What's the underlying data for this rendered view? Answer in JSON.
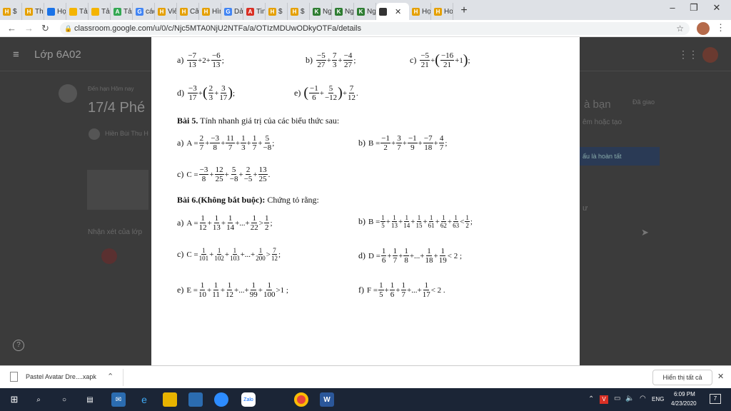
{
  "browser": {
    "tabs": [
      {
        "label": "$ ",
        "color": "#e5a000",
        "letter": "H"
      },
      {
        "label": "Thc",
        "color": "#e5a000",
        "letter": "H"
      },
      {
        "label": "Họ",
        "color": "#1a73e8",
        "letter": ""
      },
      {
        "label": "Tải",
        "color": "#f4b400",
        "letter": ""
      },
      {
        "label": "Tải",
        "color": "#f4b400",
        "letter": ""
      },
      {
        "label": "Tải",
        "color": "#34a853",
        "letter": "A"
      },
      {
        "label": "các",
        "color": "#4285f4",
        "letter": "G"
      },
      {
        "label": "Viê",
        "color": "#e5a000",
        "letter": "H"
      },
      {
        "label": "Câu",
        "color": "#e5a000",
        "letter": "H"
      },
      {
        "label": "Hìn",
        "color": "#e5a000",
        "letter": "H"
      },
      {
        "label": "Dải",
        "color": "#4285f4",
        "letter": "G"
      },
      {
        "label": "Tin",
        "color": "#d93025",
        "letter": "A"
      },
      {
        "label": "$ ",
        "color": "#e5a000",
        "letter": "H"
      },
      {
        "label": "$ ",
        "color": "#e5a000",
        "letter": "H"
      },
      {
        "label": "Ng",
        "color": "#2e7d32",
        "letter": "K"
      },
      {
        "label": "Ng",
        "color": "#2e7d32",
        "letter": "K"
      },
      {
        "label": "Ng",
        "color": "#2e7d32",
        "letter": "K"
      },
      {
        "label": "Họ",
        "color": "#e5a000",
        "letter": "H"
      },
      {
        "label": "Ho",
        "color": "#e5a000",
        "letter": "H"
      }
    ],
    "active_tab_close": "✕",
    "new_tab": "+",
    "url": "classroom.google.com/u/0/c/Njc5MTA0NjU2NTFa/a/OTIzMDUwODkyOTFa/details"
  },
  "classroom": {
    "class_name": "Lớp 6A02",
    "due": "Đến hạn Hôm nay",
    "title": "17/4 Phé",
    "teacher": "Hiền Bùi Thu H",
    "comments": "Nhận xét của lớp",
    "right_title": "à bạn",
    "assigned": "Đã giao",
    "add_create": "êm hoặc tạo",
    "mark_done": "ấu là hoàn tất",
    "private": "ư",
    "help": "?"
  },
  "doc": {
    "bai5_title": "Bài 5.",
    "bai5_text": " Tính nhanh giá trị của các biểu thức sau:",
    "bai6_title": "Bài 6.(Không bắt buộc):",
    "bai6_text": " Chứng tỏ rằng:"
  },
  "download": {
    "file": "Pastel Avatar Dre....xapk",
    "show_all": "Hiển thị tất cả",
    "close": "✕"
  },
  "taskbar": {
    "lang": "ENG",
    "time": "6:09 PM",
    "date": "4/23/2020",
    "notif": "7"
  }
}
